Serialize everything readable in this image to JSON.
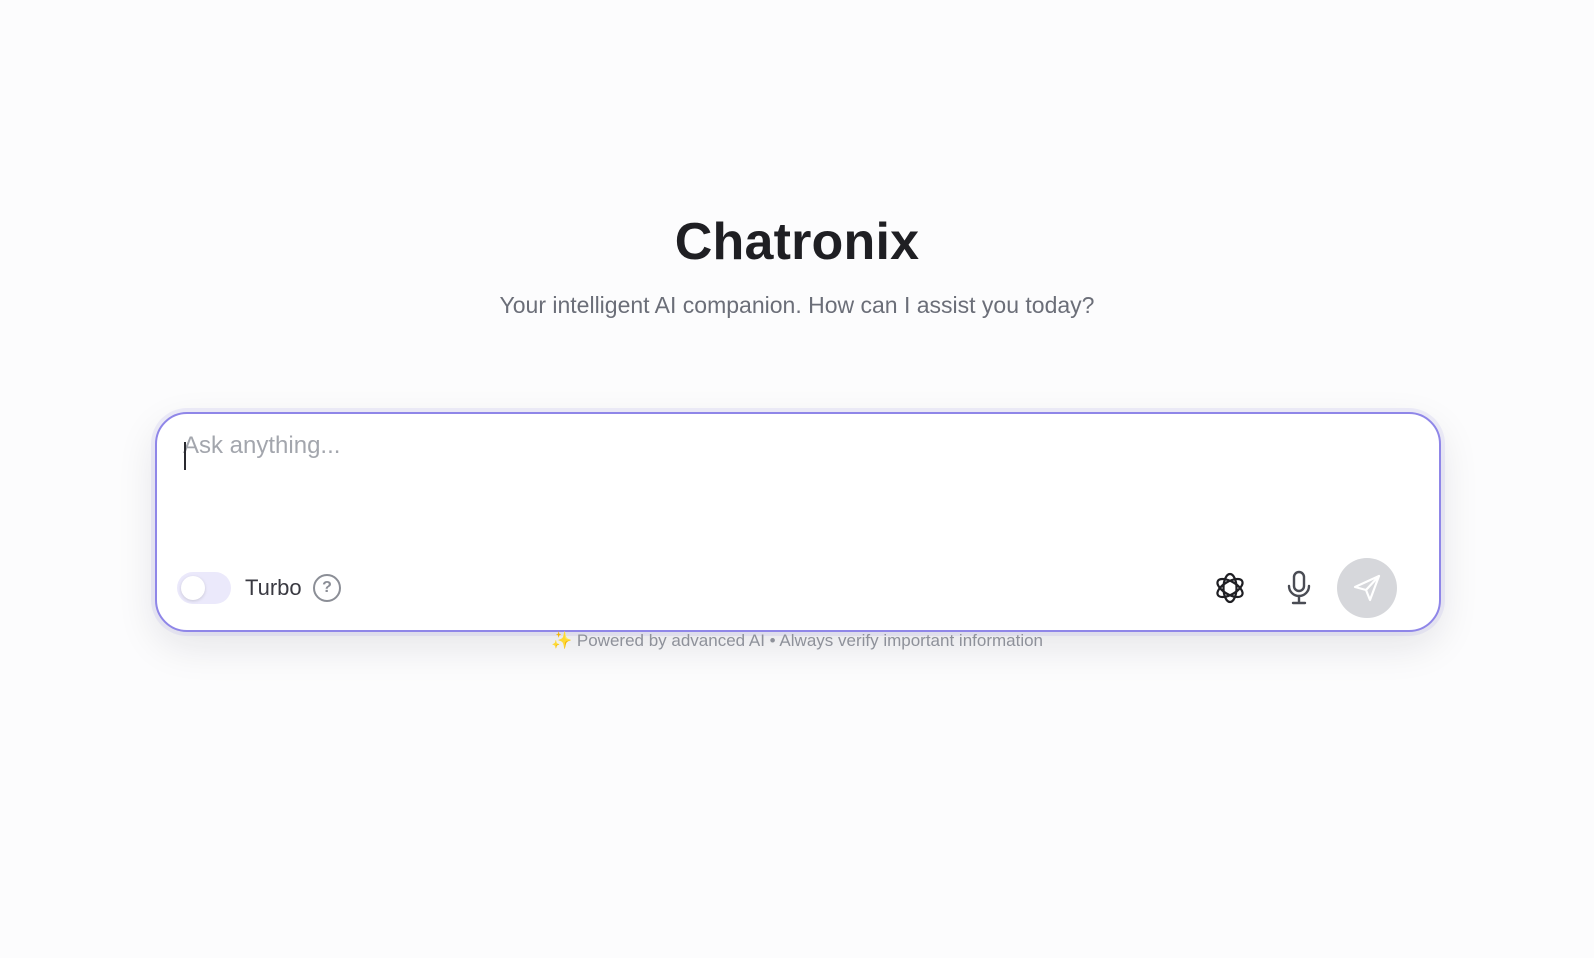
{
  "app": {
    "title": "Chatronix",
    "subtitle": "Your intelligent AI companion. How can I assist you today?"
  },
  "composer": {
    "placeholder": "Ask anything...",
    "value": "",
    "turbo_label": "Turbo",
    "turbo_enabled": false,
    "help_glyph": "?",
    "icons": {
      "help": "question-circle-icon",
      "model": "openai-logo-icon",
      "mic": "microphone-icon",
      "send": "paper-plane-icon"
    }
  },
  "footer": {
    "sparkle": "✨",
    "note": "Powered by advanced AI • Always verify important information"
  },
  "colors": {
    "accent_border": "#8f86e8",
    "toggle_track": "#ebe9fb",
    "send_disabled": "#d6d7db",
    "title_text": "#1f1f23",
    "subtitle_text": "#6b6e78"
  }
}
